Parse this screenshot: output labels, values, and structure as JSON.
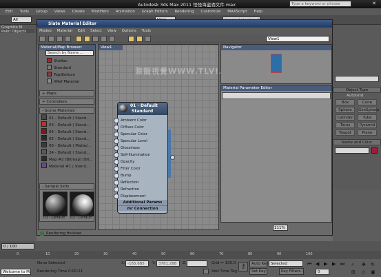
{
  "app": {
    "title": "Autodesk 3ds Max  2011      怪怪海盗酒文件.max",
    "search_placeholder": "Type a keyword or phrase",
    "menu": [
      "Edit",
      "Tools",
      "Group",
      "Views",
      "Create",
      "Modifiers",
      "Animation",
      "Graph Editors",
      "Rendering",
      "Customize",
      "MAXScript",
      "Help"
    ],
    "toolbar": {
      "filter_value": "All",
      "view_value": "View",
      "selection_set": "Create Selection Set"
    },
    "graphite_tab": "Graphite M",
    "polygon_tab": "Paint Objects"
  },
  "command_panel": {
    "dropdown": "ard Primitives",
    "object_type_head": "Object Type",
    "autogrid": "AutoGrid",
    "buttons": [
      "Box",
      "Cone",
      "Sphere",
      "GeoSphere",
      "Cylinder",
      "Tube",
      "Torus",
      "Pyramid",
      "Teapot",
      "Plane"
    ],
    "name_color_head": "Name and Color",
    "swatch_color": "#9a1f3a"
  },
  "sme": {
    "title": "Slate Material Editor",
    "menu": [
      "Modes",
      "Material",
      "Edit",
      "Select",
      "View",
      "Options",
      "Tools"
    ],
    "view_select": "View1",
    "browser_title": "Material/Map Browser",
    "search_placeholder": "Search by Name ...",
    "materials": [
      {
        "label": "Shellac",
        "color": "#b2222c"
      },
      {
        "label": "Standard",
        "color": "#7a7a7a"
      },
      {
        "label": "Top/Bottom",
        "color": "#8b3a3a"
      },
      {
        "label": "XRef Material",
        "color": "#8a8a8a"
      }
    ],
    "groups": [
      "+ Maps",
      "+ Controllers"
    ],
    "scene_group": "- Scene Materials",
    "scene_materials": [
      {
        "label": "01 - Default  ( Stand...",
        "color": "#4a4a4a"
      },
      {
        "label": "03 - Default  ( Stand...",
        "color": "#c02f2f"
      },
      {
        "label": "04 - Default  ( Stand...",
        "color": "#7a1a1a"
      },
      {
        "label": "05 - Default  ( Stand...",
        "color": "#2a2a2a"
      },
      {
        "label": "06 - Default  ( Matte/...",
        "color": "#3a3a3a"
      },
      {
        "label": "24 - Default  ( Stand...",
        "color": "#5a5a5a"
      },
      {
        "label": "Map #2 (Bitmap)  [Bit...",
        "color": "#2b2b2b"
      },
      {
        "label": "Material #1  ( Stand...",
        "color": "#6a4a8a"
      }
    ],
    "sample_slots_title": "- Sample Slots",
    "sample_slots": [
      "01 - Default",
      "02 - Default"
    ],
    "view_tab": "View1",
    "navigator_title": "Navigator",
    "param_title": "Material Parameter Editor",
    "zoom": "111%",
    "status": "Rendering finished",
    "watermark": "滁龍視覺WWW.TLVI.NET"
  },
  "node": {
    "title_line1": "01 - Default",
    "title_line2": "Standard",
    "slots": [
      "Ambient Color",
      "Diffuse Color",
      "Specular Color",
      "Specular Level",
      "Glossiness",
      "Self-Illumination",
      "Opacity",
      "Filter Color",
      "Bump",
      "Reflection",
      "Refraction",
      "Displacement"
    ],
    "foot1": "Additional Params",
    "foot2": "mr Connection"
  },
  "bottom": {
    "frame": "0 / 100",
    "ticks": [
      "0",
      "10",
      "20",
      "30",
      "40",
      "50",
      "60",
      "70",
      "80",
      "90",
      "100"
    ],
    "none_selected": "None Selected",
    "x_label": "X:",
    "x_value": "-165.685",
    "y_label": "Y:",
    "y_value": "3781.288",
    "z_label": "Z:",
    "grid": "Grid = 100.0",
    "auto_key": "Auto Key",
    "selected": "Selected",
    "set_key": "Set Key",
    "key_filters": "Key Filters...",
    "welcome": "Welcome to MAX!",
    "render_time": "Rendering Time  0:00:21",
    "add_time_tag": "Add Time Tag",
    "frame_field": "0"
  }
}
